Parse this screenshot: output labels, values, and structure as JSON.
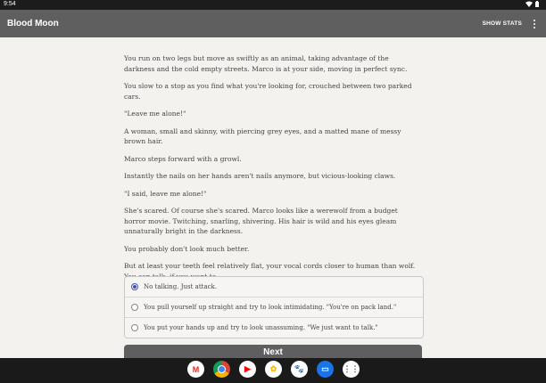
{
  "status": {
    "time": "9:54"
  },
  "app": {
    "title": "Blood Moon",
    "show_stats": "SHOW STATS"
  },
  "story": {
    "paragraphs": [
      "You run on two legs but move as swiftly as an animal, taking advantage of the darkness and the cold empty streets. Marco is at your side, moving in perfect sync.",
      "You slow to a stop as you find what you're looking for, crouched between two parked cars.",
      "\"Leave me alone!\"",
      "A woman, small and skinny, with piercing grey eyes, and a matted mane of messy brown hair.",
      "Marco steps forward with a growl.",
      "Instantly the nails on her hands aren't nails anymore, but vicious-looking claws.",
      "\"I said, leave me alone!\"",
      "She's scared. Of course she's scared. Marco looks like a werewolf from a budget horror movie. Twitching, snarling, shivering. His hair is wild and his eyes gleam unnaturally bright in the darkness.",
      "You probably don't look much better.",
      "But at least your teeth feel relatively flat, your vocal cords closer to human than wolf. You can talk, if you want to."
    ]
  },
  "choices": [
    {
      "label": "No talking. Just attack.",
      "selected": true
    },
    {
      "label": "You pull yourself up straight and try to look intimidating. \"You're on pack land.\"",
      "selected": false
    },
    {
      "label": "You put your hands up and try to look unassuming. \"We just want to talk.\"",
      "selected": false
    }
  ],
  "next_label": "Next",
  "dock": [
    {
      "name": "gmail-icon",
      "glyph": "M",
      "bg": "#ffffff",
      "fg": "#d93025"
    },
    {
      "name": "chrome-icon",
      "glyph": "",
      "bg": "#ffffff",
      "fg": "#4285f4"
    },
    {
      "name": "youtube-icon",
      "glyph": "▶",
      "bg": "#ffffff",
      "fg": "#ff0000"
    },
    {
      "name": "photos-icon",
      "glyph": "✿",
      "bg": "#ffffff",
      "fg": "#fbbc05"
    },
    {
      "name": "paw-icon",
      "glyph": "🐾",
      "bg": "#ffffff",
      "fg": "#333333"
    },
    {
      "name": "messages-icon",
      "glyph": "▭",
      "bg": "#1a73e8",
      "fg": "#ffffff"
    },
    {
      "name": "app-drawer-icon",
      "glyph": "⋮⋮",
      "bg": "#ffffff",
      "fg": "#555555"
    }
  ]
}
